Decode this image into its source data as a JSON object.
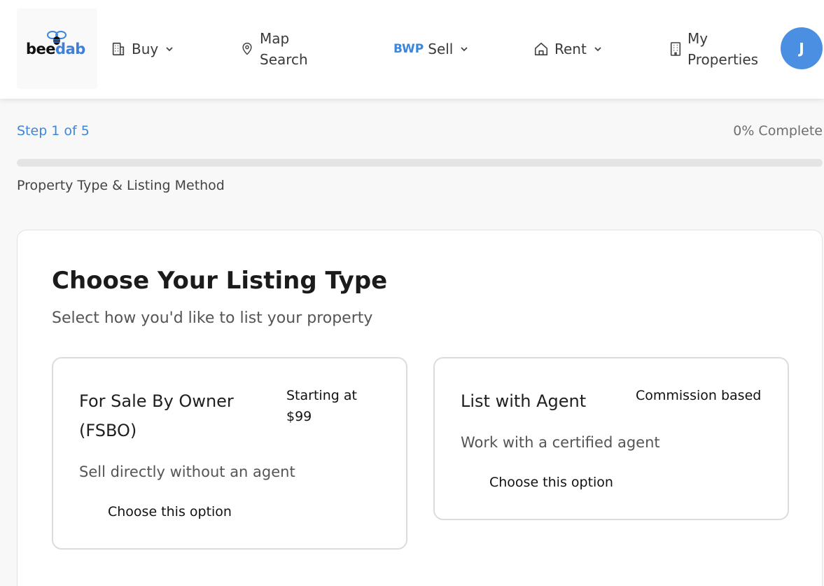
{
  "brand": {
    "logo_text_bee": "bee",
    "logo_text_dab": "dab"
  },
  "nav": {
    "buy": "Buy",
    "map_line1": "Map",
    "map_line2": "Search",
    "sell_brand": "BWP",
    "sell": "Sell",
    "rent": "Rent",
    "props_line1": "My",
    "props_line2": "Properties"
  },
  "user": {
    "avatar_initial": "J"
  },
  "progress": {
    "step_label": "Step 1 of 5",
    "complete_label": "0% Complete",
    "percent": 0,
    "step_title": "Property Type & Listing Method"
  },
  "listing": {
    "title": "Choose Your Listing Type",
    "subtitle": "Select how you'd like to list your property",
    "options": [
      {
        "title": "For Sale By Owner (FSBO)",
        "price": "Starting at $99",
        "description": "Sell directly without an agent",
        "action": "Choose this option"
      },
      {
        "title": "List with Agent",
        "price": "Commission based",
        "description": "Work with a certified agent",
        "action": "Choose this option"
      }
    ]
  },
  "colors": {
    "accent": "#3d86dd",
    "avatar_bg": "#4b8fe2"
  },
  "icons": {
    "buy": "building-icon",
    "map": "map-pin-icon",
    "rent": "house-icon",
    "props": "office-building-icon",
    "dropdown": "chevron-down-icon"
  }
}
